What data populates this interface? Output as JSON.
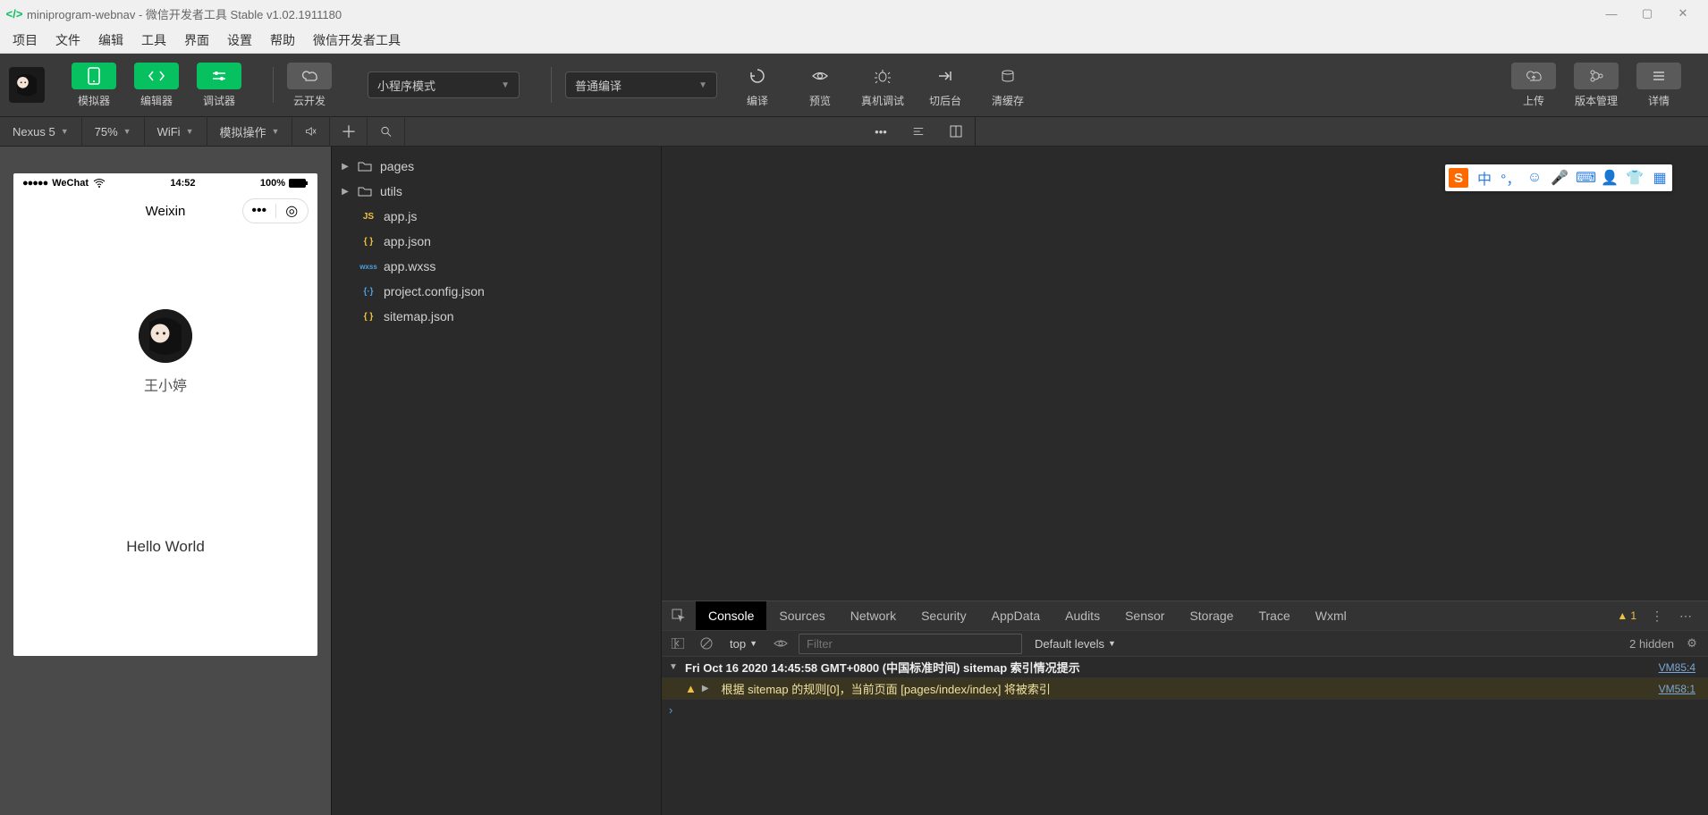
{
  "window": {
    "title": "miniprogram-webnav - 微信开发者工具 Stable v1.02.1911180"
  },
  "menubar": [
    "项目",
    "文件",
    "编辑",
    "工具",
    "界面",
    "设置",
    "帮助",
    "微信开发者工具"
  ],
  "toolbar": {
    "simulator": "模拟器",
    "editor": "编辑器",
    "debugger": "调试器",
    "cloud": "云开发",
    "mode": "小程序模式",
    "compile_mode": "普通编译",
    "compile": "编译",
    "preview": "预览",
    "remote": "真机调试",
    "background": "切后台",
    "clear_cache": "清缓存",
    "upload": "上传",
    "version": "版本管理",
    "detail": "详情"
  },
  "simbar": {
    "device": "Nexus 5",
    "zoom": "75%",
    "network": "WiFi",
    "sim_ops": "模拟操作"
  },
  "phone": {
    "carrier": "WeChat",
    "time": "14:52",
    "battery": "100%",
    "nav_title": "Weixin",
    "user_name": "王小婷",
    "hello": "Hello World"
  },
  "explorer": {
    "items": [
      {
        "type": "folder",
        "name": "pages"
      },
      {
        "type": "folder",
        "name": "utils"
      },
      {
        "type": "js",
        "name": "app.js",
        "label": "JS"
      },
      {
        "type": "json",
        "name": "app.json",
        "label": "{ }"
      },
      {
        "type": "wxss",
        "name": "app.wxss",
        "label": "wxss"
      },
      {
        "type": "cfg",
        "name": "project.config.json",
        "label": "{·}"
      },
      {
        "type": "json",
        "name": "sitemap.json",
        "label": "{ }"
      }
    ]
  },
  "ime": {
    "lang": "中"
  },
  "devtools": {
    "tabs": [
      "Console",
      "Sources",
      "Network",
      "Security",
      "AppData",
      "Audits",
      "Sensor",
      "Storage",
      "Trace",
      "Wxml"
    ],
    "active_tab": "Console",
    "warn_count": "1",
    "context": "top",
    "filter_placeholder": "Filter",
    "levels": "Default levels",
    "hidden": "2 hidden",
    "log_head": "Fri Oct 16 2020 14:45:58 GMT+0800 (中国标准时间) sitemap 索引情况提示",
    "log_head_src": "VM85:4",
    "log_warn": " 根据 sitemap 的规则[0]，当前页面 [pages/index/index] 将被索引",
    "log_warn_src": "VM58:1"
  }
}
